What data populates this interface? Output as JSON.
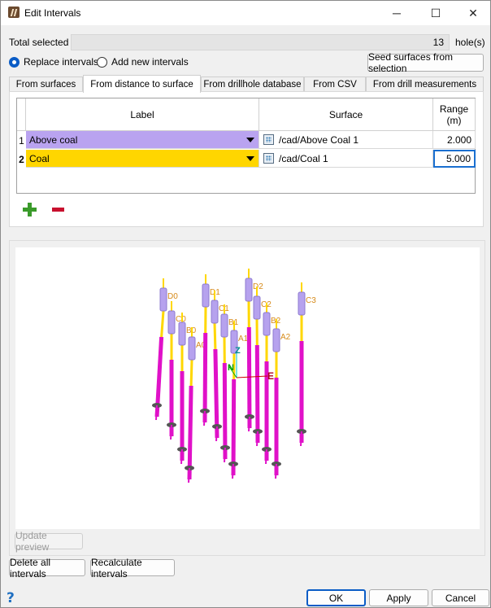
{
  "window": {
    "title": "Edit Intervals",
    "minimize": "─",
    "maximize": "☐",
    "close": "✕"
  },
  "selection": {
    "total_label": "Total selected",
    "count": "13",
    "unit": "hole(s)"
  },
  "mode": {
    "replace_label": "Replace intervals",
    "add_label": "Add new intervals",
    "selected": "replace"
  },
  "seed_button": "Seed surfaces from selection",
  "tabs": [
    {
      "label": "From surfaces"
    },
    {
      "label": "From distance to surface"
    },
    {
      "label": "From drillhole database"
    },
    {
      "label": "From CSV"
    },
    {
      "label": "From drill measurements"
    }
  ],
  "active_tab": "From distance to surface",
  "table": {
    "headers": {
      "label": "Label",
      "surface": "Surface",
      "range": "Range\n(m)"
    },
    "rows": [
      {
        "num": "1",
        "label": "Above coal",
        "color": "#b9a3f0",
        "surface": "/cad/Above Coal 1",
        "range": "2.000"
      },
      {
        "num": "2",
        "label": "Coal",
        "color": "#ffd600",
        "surface": "/cad/Coal 1",
        "range": "5.000"
      }
    ]
  },
  "preview": {
    "update_button": "Update preview",
    "axis_z": "Z",
    "axis_e": "E",
    "axis_n": "N",
    "hole_labels": [
      "D0",
      "C0",
      "B0",
      "A0",
      "D1",
      "C1",
      "B1",
      "A1",
      "D2",
      "C2",
      "B2",
      "A2",
      "C3"
    ]
  },
  "footer": {
    "delete_all": "Delete all intervals",
    "recalculate": "Recalculate intervals",
    "help": "?",
    "ok": "OK",
    "apply": "Apply",
    "cancel": "Cancel"
  }
}
